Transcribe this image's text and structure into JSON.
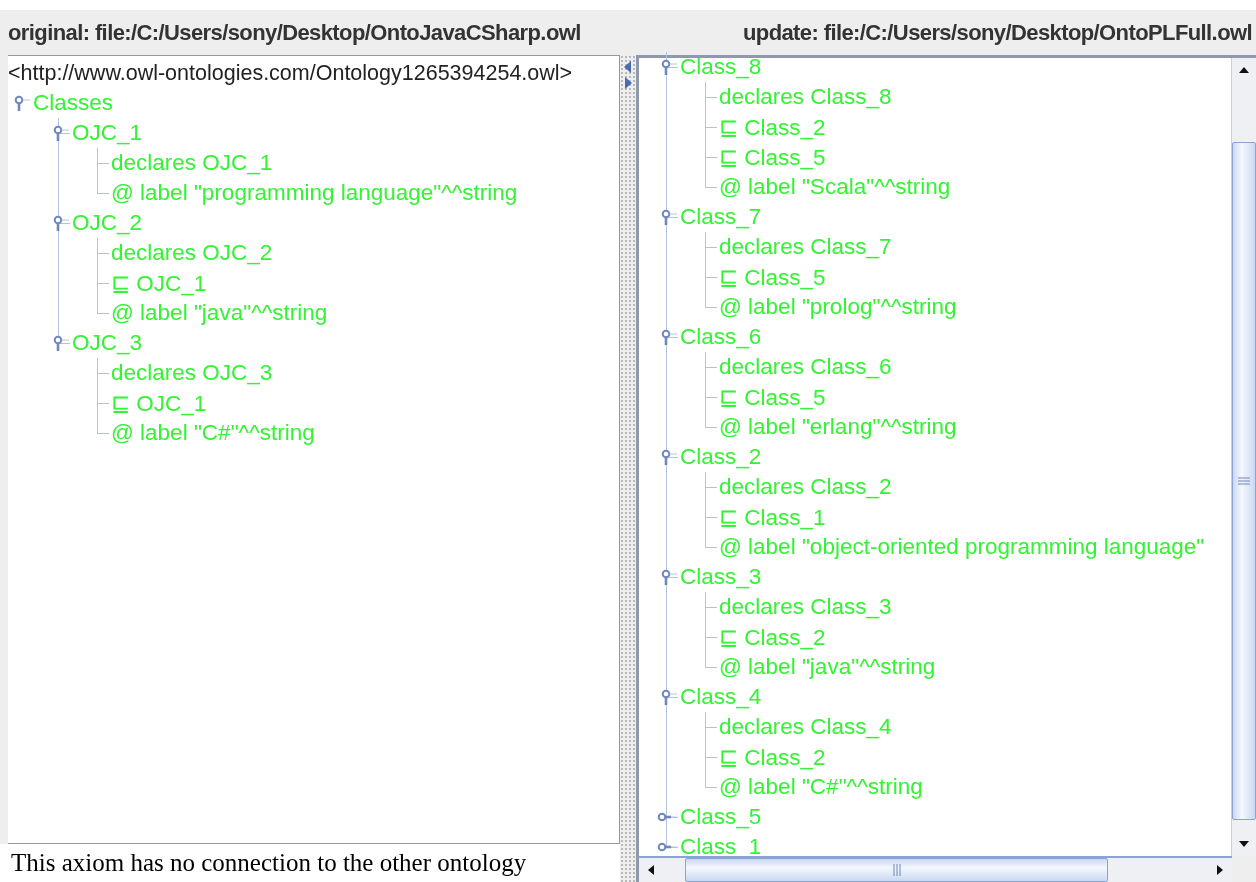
{
  "left": {
    "title": "original: file:/C:/Users/sony/Desktop/OntoJavaCSharp.owl",
    "ontology": "<http://www.owl-ontologies.com/Ontology1265394254.owl>",
    "tree": [
      {
        "kind": "branch",
        "label": "Classes",
        "expanded": true,
        "children": [
          {
            "kind": "branch",
            "label": "OJC_1",
            "expanded": true,
            "children": [
              {
                "kind": "leaf",
                "label": "declares OJC_1"
              },
              {
                "kind": "leaf",
                "label": "@ label \"programming language\"^^string"
              }
            ]
          },
          {
            "kind": "branch",
            "label": "OJC_2",
            "expanded": true,
            "children": [
              {
                "kind": "leaf",
                "label": "declares OJC_2"
              },
              {
                "kind": "leaf",
                "label": "⊑ OJC_1"
              },
              {
                "kind": "leaf",
                "label": "@ label \"java\"^^string"
              }
            ]
          },
          {
            "kind": "branch",
            "label": "OJC_3",
            "expanded": true,
            "children": [
              {
                "kind": "leaf",
                "label": "declares OJC_3"
              },
              {
                "kind": "leaf",
                "label": "⊑ OJC_1"
              },
              {
                "kind": "leaf",
                "label": "@ label \"C#\"^^string"
              }
            ]
          }
        ]
      }
    ],
    "status": "This axiom has no connection to the other ontology"
  },
  "right": {
    "title": "update: file:/C:/Users/sony/Desktop/OntoPLFull.owl",
    "tree": [
      {
        "kind": "branch",
        "label": "Class_8",
        "expanded": true,
        "children": [
          {
            "kind": "leaf",
            "label": "declares Class_8"
          },
          {
            "kind": "leaf",
            "label": "⊑ Class_2"
          },
          {
            "kind": "leaf",
            "label": "⊑ Class_5"
          },
          {
            "kind": "leaf",
            "label": "@ label \"Scala\"^^string"
          }
        ]
      },
      {
        "kind": "branch",
        "label": "Class_7",
        "expanded": true,
        "children": [
          {
            "kind": "leaf",
            "label": "declares Class_7"
          },
          {
            "kind": "leaf",
            "label": "⊑ Class_5"
          },
          {
            "kind": "leaf",
            "label": "@ label \"prolog\"^^string"
          }
        ]
      },
      {
        "kind": "branch",
        "label": "Class_6",
        "expanded": true,
        "children": [
          {
            "kind": "leaf",
            "label": "declares Class_6"
          },
          {
            "kind": "leaf",
            "label": "⊑ Class_5"
          },
          {
            "kind": "leaf",
            "label": "@ label \"erlang\"^^string"
          }
        ]
      },
      {
        "kind": "branch",
        "label": "Class_2",
        "expanded": true,
        "children": [
          {
            "kind": "leaf",
            "label": "declares Class_2"
          },
          {
            "kind": "leaf",
            "label": "⊑ Class_1"
          },
          {
            "kind": "leaf",
            "label": "@ label \"object-oriented programming language\""
          }
        ]
      },
      {
        "kind": "branch",
        "label": "Class_3",
        "expanded": true,
        "children": [
          {
            "kind": "leaf",
            "label": "declares Class_3"
          },
          {
            "kind": "leaf",
            "label": "⊑ Class_2"
          },
          {
            "kind": "leaf",
            "label": "@ label \"java\"^^string"
          }
        ]
      },
      {
        "kind": "branch",
        "label": "Class_4",
        "expanded": true,
        "children": [
          {
            "kind": "leaf",
            "label": "declares Class_4"
          },
          {
            "kind": "leaf",
            "label": "⊑ Class_2"
          },
          {
            "kind": "leaf",
            "label": "@ label \"C#\"^^string"
          }
        ]
      },
      {
        "kind": "branch",
        "label": "Class_5",
        "expanded": false
      },
      {
        "kind": "branch",
        "label": "Class_1",
        "expanded": false
      }
    ]
  }
}
